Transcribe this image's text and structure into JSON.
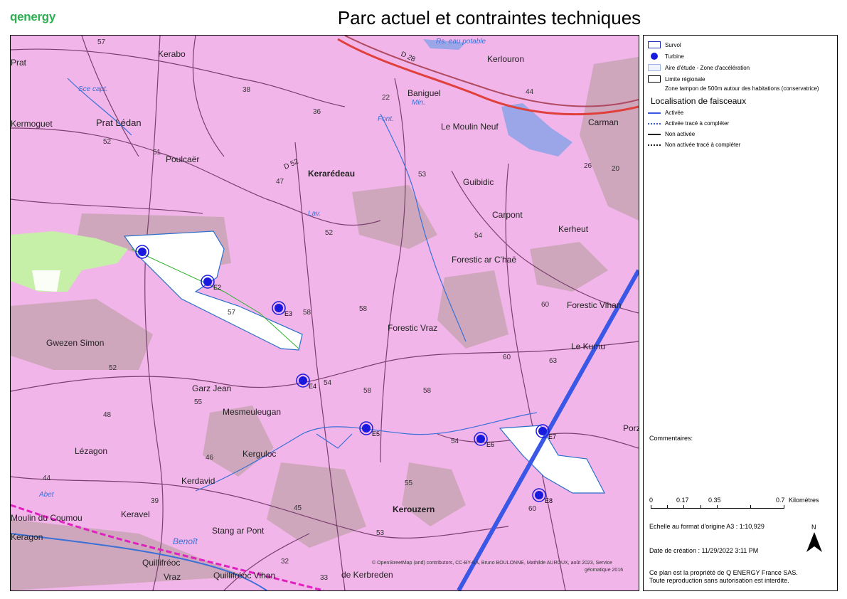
{
  "header": {
    "logo_text": "qenergy",
    "title": "Parc actuel et contraintes techniques"
  },
  "legend": {
    "items": [
      {
        "label": "Survol",
        "swatch": "survol"
      },
      {
        "label": "Turbine",
        "swatch": "dot"
      },
      {
        "label": "Aire d'étude - Zone d'accélération",
        "swatch": "aire"
      },
      {
        "label": "Limite régionale",
        "swatch": "limite"
      },
      {
        "label": "Zone tampon de 500m autour des habitations (conservatrice)",
        "swatch": "none"
      }
    ],
    "faisceaux_title": "Localisation de faisceaux",
    "faisceaux": [
      {
        "label": "Activée",
        "style": "solid-blue"
      },
      {
        "label": "Activée tracé à compléter",
        "style": "dotted-blue"
      },
      {
        "label": "Non activée",
        "style": "solid-black"
      },
      {
        "label": "Non activée tracé à compléter",
        "style": "dotted-black"
      }
    ],
    "comments_label": "Commentaires:",
    "scale": {
      "ticks": [
        "0",
        "0.17",
        "0.35",
        "0.7"
      ],
      "unit": "Kilomètres"
    },
    "echelle": "Echelle au format d'origine A3 : 1:10,929",
    "date": "Date de création : 11/29/2022 3:11 PM",
    "north_label": "N",
    "copyright_line1": "Ce plan est la propriété de Q ENERGY France SAS.",
    "copyright_line2": "Toute reproduction sans autorisation est interdite."
  },
  "map": {
    "attribution_line1": "© OpenStreetMap (and) contributors, CC-BY-SA, Bruno BOULONNE, Mathilde AUROUX, août 2023, Service",
    "attribution_line2": "géomatique 2016",
    "turbines": [
      "E2",
      "E3",
      "E4",
      "E5",
      "E6",
      "E7",
      "E8"
    ],
    "place_names": [
      "Kerabo",
      "Kerlouron",
      "Prat",
      "Prat Lédan",
      "Kermoguet",
      "Poulcaër",
      "Kerarédeau",
      "Baniguel",
      "Le Moulin Neuf",
      "Carman",
      "Guibidic",
      "Carpont",
      "Kerheut",
      "Forestic ar C'haë",
      "Forestic Vraz",
      "Forestic Vihan",
      "Le Kumu",
      "Gwezen Simon",
      "Garz Jean",
      "Mesmeuleugan",
      "Kerguloc",
      "Lézagon",
      "Kerdavid",
      "Keravel",
      "Kerouzern",
      "Stang ar Pont",
      "Quillifréoc",
      "Vraz",
      "Quillifréoc Vihan",
      "Moulin du Coumou",
      "Keragon",
      "Porz",
      "de Kerbreden",
      "Benoît",
      "Abet",
      "Sce capt.",
      "Font.",
      "Lav.",
      "Min.",
      "Rs. eau potable",
      "D 52",
      "D 28"
    ],
    "elevations": [
      "57",
      "38",
      "22",
      "36",
      "44",
      "52",
      "51",
      "47",
      "53",
      "54",
      "52",
      "60",
      "57",
      "58",
      "58",
      "60",
      "63",
      "52",
      "55",
      "48",
      "54",
      "58",
      "58",
      "46",
      "44",
      "39",
      "45",
      "54",
      "53",
      "32",
      "33",
      "26",
      "20",
      "60",
      "55"
    ],
    "colors": {
      "zone": "#f2b5e9",
      "road": "#7a3f6f",
      "water": "#3a70d8",
      "faisceau": "#3b57e6",
      "turbine": "#1a1adf",
      "woods": "#c8a9b0",
      "green": "#c6f0a8"
    }
  }
}
